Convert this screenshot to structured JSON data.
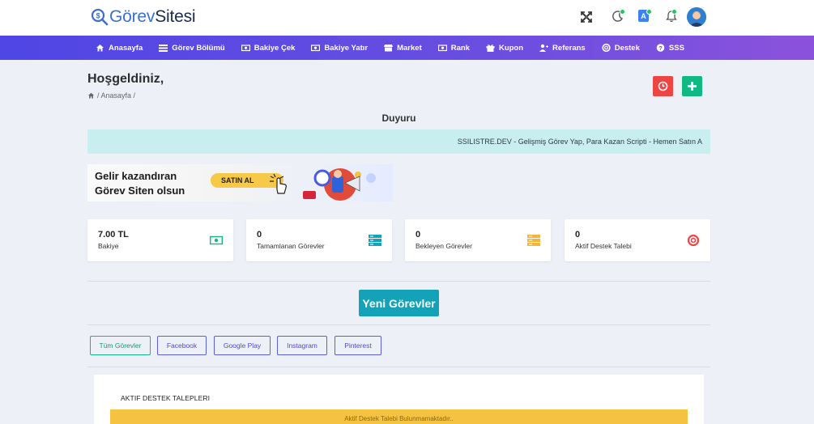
{
  "brand": {
    "part1": "Görev",
    "part2": "Sitesi",
    "color": "#3b6fd8"
  },
  "nav": [
    {
      "label": "Anasayfa",
      "icon": "home-icon"
    },
    {
      "label": "Görev Bölümü",
      "icon": "list-icon"
    },
    {
      "label": "Bakiye Çek",
      "icon": "money-icon"
    },
    {
      "label": "Bakiye Yatır",
      "icon": "money-icon"
    },
    {
      "label": "Market",
      "icon": "store-icon"
    },
    {
      "label": "Rank",
      "icon": "money-icon"
    },
    {
      "label": "Kupon",
      "icon": "gift-icon"
    },
    {
      "label": "Referans",
      "icon": "user-plus-icon"
    },
    {
      "label": "Destek",
      "icon": "life-ring-icon"
    },
    {
      "label": "SSS",
      "icon": "question-icon"
    }
  ],
  "page": {
    "title": "Hoşgeldiniz,",
    "breadcrumb": "/ Anasayfa /"
  },
  "announcement": {
    "heading": "Duyuru",
    "text": "SSILISTRE.DEV - Gelişmiş Görev Yap, Para Kazan Scripti - Hemen Satın A"
  },
  "banner": {
    "line1": "Gelir kazandıran",
    "line2": "Görev Siten olsun",
    "cta": "SATIN AL"
  },
  "stats": [
    {
      "value": "7.00 TL",
      "label": "Bakiye",
      "icon": "money-bill-icon",
      "color": "#10b981"
    },
    {
      "value": "0",
      "label": "Tamamlanan Görevler",
      "icon": "server-icon",
      "color": "#14a2b8"
    },
    {
      "value": "0",
      "label": "Bekleyen Görevler",
      "icon": "server-icon",
      "color": "#f5b53a"
    },
    {
      "value": "0",
      "label": "Aktif Destek Talebi",
      "icon": "life-ring-icon",
      "color": "#ef4444"
    }
  ],
  "new_tasks_button": "Yeni Görevler",
  "filters": [
    "Tüm Görevler",
    "Facebook",
    "Google Play",
    "Instagram",
    "Pinterest"
  ],
  "support": {
    "heading": "AKTIF DESTEK TALEPLERI",
    "empty": "Aktif Destek Talebi Bulunmamaktadır.."
  }
}
